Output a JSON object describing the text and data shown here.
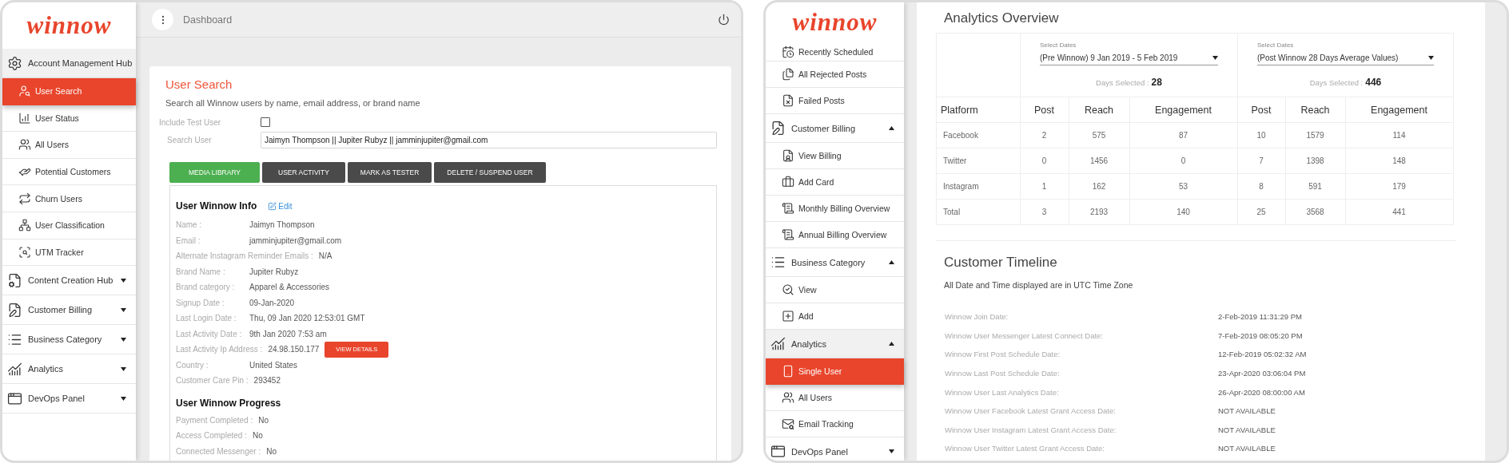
{
  "left_screen": {
    "logo": "winnow",
    "sidebar": [
      {
        "kind": "group",
        "label": "Account Management Hub",
        "expanded": true,
        "children": [
          {
            "label": "User Search",
            "selected": true
          },
          {
            "label": "User Status",
            "selected": false
          },
          {
            "label": "All Users",
            "selected": false
          },
          {
            "label": "Potential Customers",
            "selected": false
          },
          {
            "label": "Churn Users",
            "selected": false
          },
          {
            "label": "User Classification",
            "selected": false
          },
          {
            "label": "UTM Tracker",
            "selected": false
          }
        ]
      },
      {
        "kind": "group",
        "label": "Content Creation Hub",
        "expanded": false
      },
      {
        "kind": "group",
        "label": "Customer Billing",
        "expanded": false
      },
      {
        "kind": "group",
        "label": "Business Category",
        "expanded": false
      },
      {
        "kind": "group",
        "label": "Analytics",
        "expanded": false
      },
      {
        "kind": "group",
        "label": "DevOps Panel",
        "expanded": false
      }
    ],
    "topbar": {
      "title": "Dashboard"
    },
    "card": {
      "title": "User Search",
      "subtitle": "Search all Winnow users by name, email address, or brand name",
      "include_test": {
        "label": "Include Test User",
        "checked": false
      },
      "search": {
        "label": "Search User",
        "value": "Jaimyn Thompson || Jupiter Rubyz || jamminjupiter@gmail.com"
      },
      "actions": [
        {
          "label": "MEDIA LIBRARY",
          "selected": true
        },
        {
          "label": "USER ACTIVITY",
          "selected": false
        },
        {
          "label": "MARK AS TESTER",
          "selected": false
        },
        {
          "label": "DELETE / SUSPEND USER",
          "selected": false
        }
      ],
      "info": {
        "title": "User Winnow Info",
        "edit": "Edit",
        "fields": [
          {
            "label": "Name :",
            "value": "Jaimyn Thompson"
          },
          {
            "label": "Email :",
            "value": "jamminjupiter@gmail.com"
          },
          {
            "label": "Alternate Instagram Reminder Emails :",
            "value": "N/A"
          },
          {
            "label": "Brand Name :",
            "value": "Jupiter Rubyz"
          },
          {
            "label": "Brand category :",
            "value": "Apparel & Accessories"
          },
          {
            "label": "Signup Date :",
            "value": "09-Jan-2020"
          },
          {
            "label": "Last Login Date :",
            "value": "Thu, 09 Jan 2020 12:53:01 GMT"
          },
          {
            "label": "Last Activity Date :",
            "value": "9th Jan 2020 7:53 am"
          },
          {
            "label": "Last Activity Ip Address :",
            "value": "24.98.150.177",
            "action": "VIEW DETAILS"
          },
          {
            "label": "Country :",
            "value": "United States"
          },
          {
            "label": "Customer Care Pin :",
            "value": "293452"
          }
        ]
      },
      "progress": {
        "title": "User Winnow Progress",
        "fields": [
          {
            "label": "Payment Completed :",
            "value": "No"
          },
          {
            "label": "Access Completed :",
            "value": "No"
          },
          {
            "label": "Connected Messenger :",
            "value": "No"
          }
        ]
      }
    }
  },
  "right_screen": {
    "logo": "winnow",
    "sidebar": [
      {
        "kind": "item",
        "label": "Recently Scheduled",
        "selected": false
      },
      {
        "kind": "item",
        "label": "All Rejected Posts",
        "selected": false
      },
      {
        "kind": "item",
        "label": "Failed Posts",
        "selected": false
      },
      {
        "kind": "group",
        "label": "Customer Billing",
        "expanded": true,
        "children": [
          {
            "label": "View Billing",
            "selected": false
          },
          {
            "label": "Add Card",
            "selected": false
          },
          {
            "label": "Monthly Billing Overview",
            "selected": false
          },
          {
            "label": "Annual Billing Overview",
            "selected": false
          }
        ]
      },
      {
        "kind": "group",
        "label": "Business Category",
        "expanded": true,
        "children": [
          {
            "label": "View",
            "selected": false
          },
          {
            "label": "Add",
            "selected": false
          }
        ]
      },
      {
        "kind": "group",
        "label": "Analytics",
        "expanded": true,
        "children": [
          {
            "label": "Single User",
            "selected": true
          },
          {
            "label": "All Users",
            "selected": false
          },
          {
            "label": "Email Tracking",
            "selected": false
          }
        ]
      },
      {
        "kind": "group",
        "label": "DevOps Panel",
        "expanded": false
      }
    ],
    "analytics": {
      "title": "Analytics Overview",
      "periods": [
        {
          "label": "Select Dates",
          "value": "(Pre Winnow) 9 Jan 2019 - 5 Feb 2019",
          "days_label": "Days Selected :",
          "days": "28"
        },
        {
          "label": "Select Dates",
          "value": "(Post Winnow 28 Days Average Values)",
          "days_label": "Days Selected :",
          "days": "446"
        }
      ],
      "columns": [
        "Platform",
        "Post",
        "Reach",
        "Engagement",
        "Post",
        "Reach",
        "Engagement"
      ],
      "rows": [
        [
          "Facebook",
          "2",
          "575",
          "87",
          "10",
          "1579",
          "114"
        ],
        [
          "Twitter",
          "0",
          "1456",
          "0",
          "7",
          "1398",
          "148"
        ],
        [
          "Instagram",
          "1",
          "162",
          "53",
          "8",
          "591",
          "179"
        ],
        [
          "Total",
          "3",
          "2193",
          "140",
          "25",
          "3568",
          "441"
        ]
      ]
    },
    "timeline": {
      "title": "Customer Timeline",
      "note": "All Date and Time displayed are in UTC Time Zone",
      "rows": [
        {
          "label": "Winnow Join Date:",
          "value": "2-Feb-2019 11:31:29 PM"
        },
        {
          "label": "Winnow User Messenger Latest Connect Date:",
          "value": "7-Feb-2019 08:05:20 PM"
        },
        {
          "label": "Winnow First Post Schedule Date:",
          "value": "12-Feb-2019 05:02:32 AM"
        },
        {
          "label": "Winnow Last Post Schedule Date:",
          "value": "23-Apr-2020 03:06:04 PM"
        },
        {
          "label": "Winnow User Last Analytics Date:",
          "value": "26-Apr-2020 08:00:00 AM"
        },
        {
          "label": "Winnow User Facebook Latest Grant Access Date:",
          "value": "NOT AVAILABLE"
        },
        {
          "label": "Winnow User Instagram Latest Grant Access Date:",
          "value": "NOT AVAILABLE"
        },
        {
          "label": "Winnow User Twitter Latest Grant Access Date:",
          "value": "NOT AVAILABLE"
        }
      ]
    }
  }
}
